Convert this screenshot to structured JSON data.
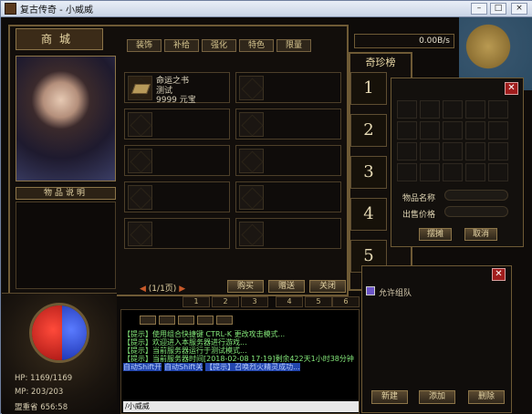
{
  "window": {
    "title": "复古传奇 - 小威威",
    "controls": [
      "minimize",
      "maximize",
      "close"
    ]
  },
  "shop": {
    "title": "商城",
    "tabs": [
      "装饰",
      "补给",
      "强化",
      "特色",
      "限量"
    ],
    "items": [
      {
        "name": "命运之书",
        "sub": "测试",
        "price": "9999 元宝"
      }
    ],
    "page": "(1/1页)",
    "buttons": {
      "buy": "购买",
      "gift": "赠送",
      "close": "关闭"
    },
    "desc_title": "物品说明"
  },
  "net": {
    "speed": "0.00B/s"
  },
  "ranking": {
    "title": "奇珍榜",
    "numbers": [
      "1",
      "2",
      "3",
      "4",
      "5"
    ]
  },
  "sell_dialog": {
    "name_label": "物品名称",
    "price_label": "出售价格",
    "confirm": "摆摊",
    "cancel": "取消"
  },
  "team": {
    "allow_label": "允许组队",
    "buttons": {
      "new": "新建",
      "add": "添加",
      "remove": "删除"
    }
  },
  "hud": {
    "hp": "HP: 1169/1169",
    "mp": "MP: 203/203",
    "location": "盟重省 656:58"
  },
  "quickbar": [
    "1",
    "2",
    "3",
    "4",
    "5",
    "6"
  ],
  "chat": {
    "lines": [
      {
        "text": "【提示】使用组合快捷键 CTRL-K 更改攻击模式...",
        "style": "g"
      },
      {
        "text": "【提示】欢迎进入本服务器进行游戏...",
        "style": "g"
      },
      {
        "text": "【提示】当前服务器运行于测试模式...",
        "style": "g"
      },
      {
        "text": "【提示】当前服务器时间[2018-02-08 17:19]剩余422天1小时38分钟",
        "style": "g"
      },
      {
        "text": "自动Shift开",
        "style": "b"
      },
      {
        "text": "自动Shift关",
        "style": "b"
      },
      {
        "text": "【提示】召唤烈火精灵成功...",
        "style": "b"
      }
    ],
    "input": "/小威威"
  },
  "colors": {
    "accent": "#6e5a35",
    "hp": "#c92020",
    "mp": "#1f3fd6"
  }
}
